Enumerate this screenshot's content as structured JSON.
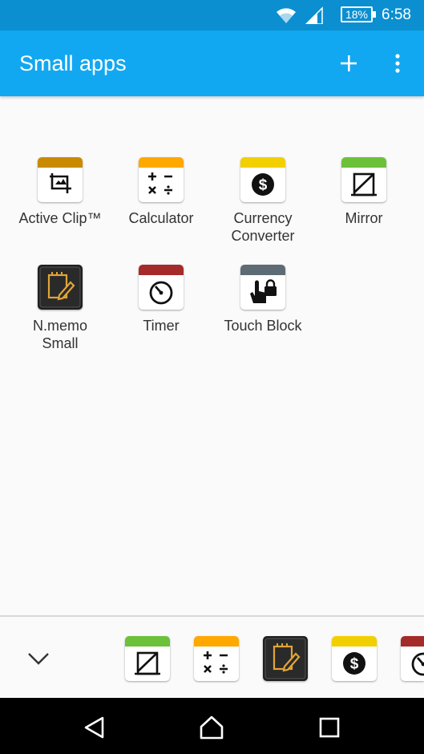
{
  "status": {
    "battery": "18%",
    "time": "6:58"
  },
  "appbar": {
    "title": "Small apps",
    "add_icon": "plus-icon",
    "menu_icon": "more-vert-icon"
  },
  "colors": {
    "status_bar": "#0b8fd1",
    "app_bar": "#12a8f1"
  },
  "apps": [
    {
      "label": "Active Clip™",
      "icon": "crop-icon",
      "band": "#c98a00"
    },
    {
      "label": "Calculator",
      "icon": "calculator-icon",
      "band": "#ffa800"
    },
    {
      "label": "Currency Converter",
      "icon": "dollar-icon",
      "band": "#f2d000"
    },
    {
      "label": "Mirror",
      "icon": "mirror-icon",
      "band": "#6cc13a"
    },
    {
      "label": "N.memo Small",
      "icon": "memo-pencil-icon",
      "band": "#222222"
    },
    {
      "label": "Timer",
      "icon": "timer-icon",
      "band": "#a52a2a"
    },
    {
      "label": "Touch Block",
      "icon": "touch-lock-icon",
      "band": "#5d6b74"
    }
  ],
  "tray": {
    "collapse_icon": "chevron-down-icon",
    "items": [
      "mirror-icon",
      "calculator-icon",
      "memo-pencil-icon",
      "dollar-icon",
      "timer-icon"
    ]
  },
  "nav": {
    "back_icon": "back-icon",
    "home_icon": "home-icon",
    "recents_icon": "recents-icon"
  }
}
